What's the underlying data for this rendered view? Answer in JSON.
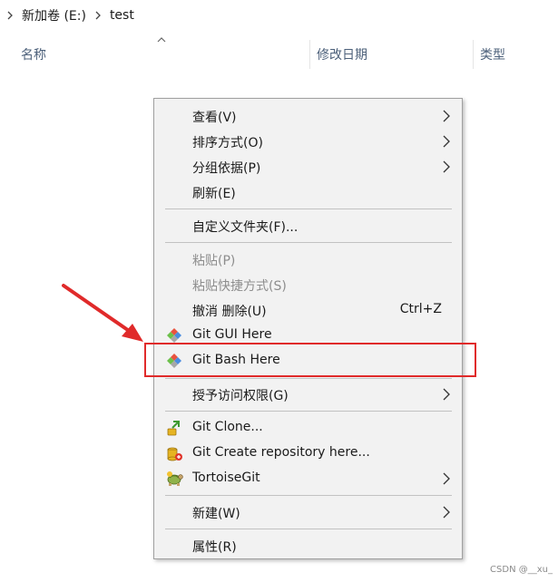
{
  "breadcrumb": {
    "items": [
      "新加卷 (E:)",
      "test"
    ]
  },
  "columns": {
    "name": "名称",
    "modified": "修改日期",
    "type": "类型"
  },
  "context_menu": {
    "items": [
      {
        "label": "查看(V)",
        "submenu": true
      },
      {
        "label": "排序方式(O)",
        "submenu": true
      },
      {
        "label": "分组依据(P)",
        "submenu": true
      },
      {
        "label": "刷新(E)"
      },
      {
        "label": "自定义文件夹(F)..."
      },
      {
        "label": "粘贴(P)",
        "disabled": true
      },
      {
        "label": "粘贴快捷方式(S)",
        "disabled": true
      },
      {
        "label": "撤消 删除(U)",
        "shortcut": "Ctrl+Z"
      },
      {
        "label": "Git GUI Here",
        "icon": "git-diamond-icon"
      },
      {
        "label": "Git Bash Here",
        "icon": "git-diamond-icon"
      },
      {
        "label": "授予访问权限(G)",
        "submenu": true
      },
      {
        "label": "Git Clone...",
        "icon": "tortoisegit-clone-icon"
      },
      {
        "label": "Git Create repository here...",
        "icon": "tortoisegit-create-repo-icon"
      },
      {
        "label": "TortoiseGit",
        "icon": "tortoisegit-icon",
        "submenu": true
      },
      {
        "label": "新建(W)",
        "submenu": true
      },
      {
        "label": "属性(R)"
      }
    ]
  },
  "annotation": {
    "highlight_color": "#e02a2a"
  },
  "watermark": "CSDN @__xu_"
}
